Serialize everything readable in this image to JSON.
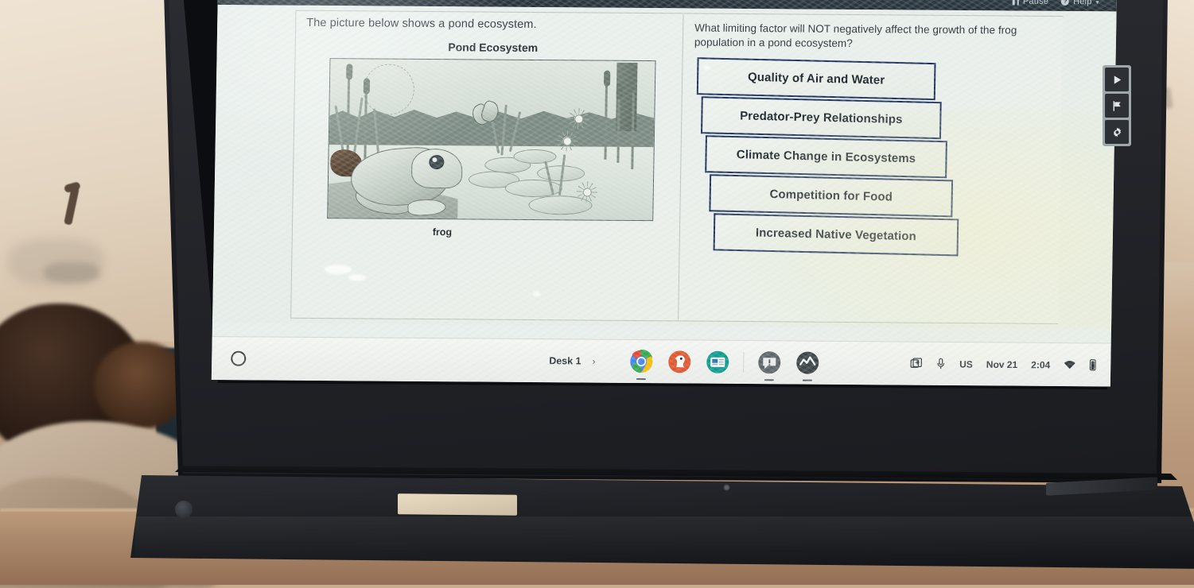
{
  "app": {
    "header": {
      "pause_label": "Pause",
      "help_label": "Help",
      "caret": "▾",
      "pause_icon": "pause-icon",
      "help_icon": "help-circle-icon"
    },
    "left_panel": {
      "stem": "The picture below shows a pond ecosystem.",
      "image_title": "Pond Ecosystem",
      "image_caption": "frog",
      "image_alt": "pond-ecosystem-illustration"
    },
    "right_panel": {
      "question": "What limiting factor will NOT negatively affect the growth of the frog population in a pond ecosystem?",
      "choices": [
        "Quality of Air and Water",
        "Predator-Prey Relationships",
        "Climate Change in Ecosystems",
        "Competition for Food",
        "Increased Native Vegetation"
      ]
    },
    "toolbar": {
      "items": [
        {
          "name": "play-icon",
          "label": "Play"
        },
        {
          "name": "flag-icon",
          "label": "Flag"
        },
        {
          "name": "gear-icon",
          "label": "Settings"
        }
      ]
    }
  },
  "shelf": {
    "launcher_icon": "launcher-circle-icon",
    "desk_label": "Desk 1",
    "desk_caret": "›",
    "apps": [
      {
        "name": "chrome-icon",
        "label": "Chrome"
      },
      {
        "name": "duckduckgo-icon",
        "label": "Search"
      },
      {
        "name": "news-app-icon",
        "label": "Docs"
      },
      {
        "name": "announcement-icon",
        "label": "Announcements"
      },
      {
        "name": "activity-icon",
        "label": "Activity"
      }
    ],
    "tray": {
      "capture_icon": "screen-capture-icon",
      "mic_icon": "microphone-icon",
      "keyboard_layout": "US",
      "date": "Nov 21",
      "time": "2:04",
      "wifi_icon": "wifi-icon",
      "battery_icon": "battery-icon"
    }
  },
  "colors": {
    "header_bg": "#2f3c47",
    "choice_border": "#1c2f5e",
    "screen_bg": "#e8efee",
    "shelf_bg": "#f4f6f5"
  }
}
